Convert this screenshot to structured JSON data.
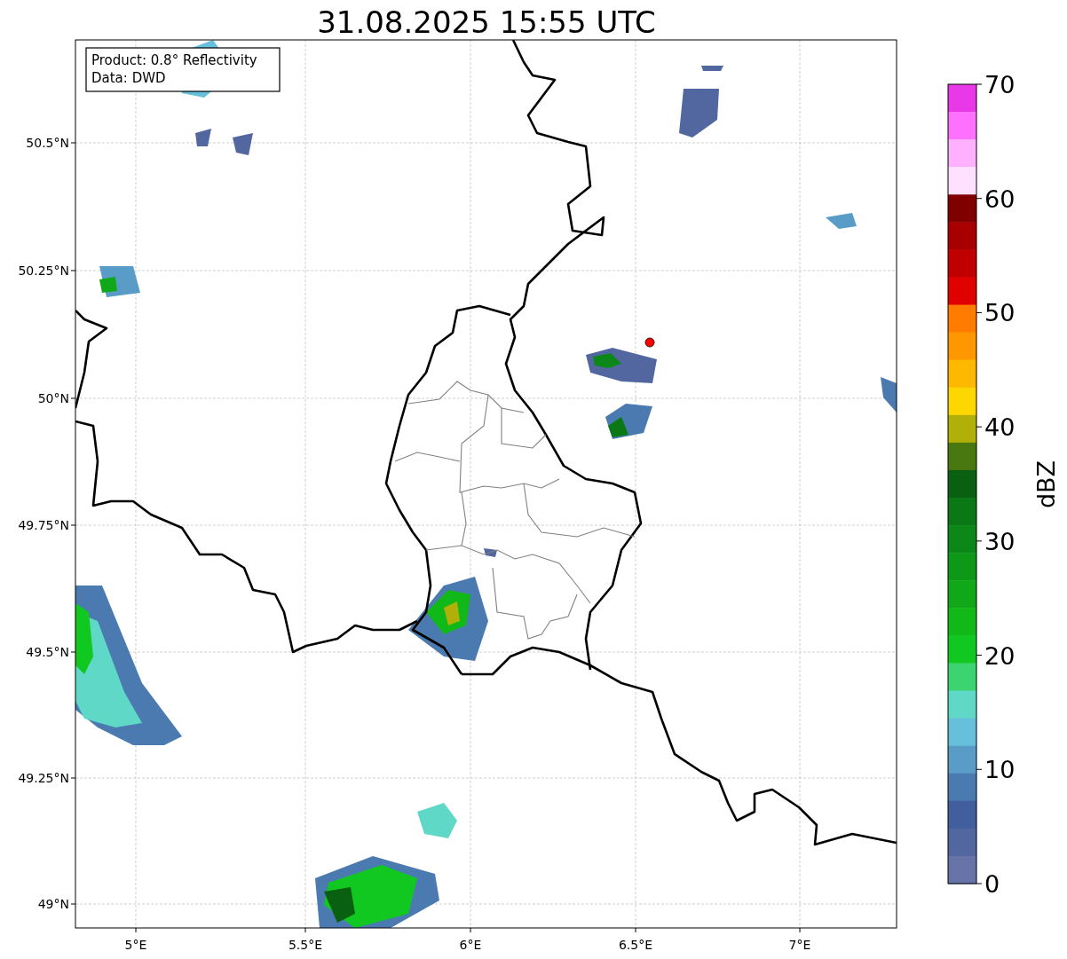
{
  "title": "31.08.2025 15:55 UTC",
  "map": {
    "info_box": [
      "Product: 0.8° Reflectivity",
      "Data: DWD"
    ],
    "xticks": [
      "5°E",
      "5.5°E",
      "6°E",
      "6.5°E",
      "7°E"
    ],
    "yticks": [
      "50.5°N",
      "50.25°N",
      "50°N",
      "49.75°N",
      "49.5°N",
      "49.25°N",
      "49°N"
    ]
  },
  "colorbar": {
    "label": "dBZ",
    "ticks": [
      "70",
      "60",
      "50",
      "40",
      "30",
      "20",
      "10",
      "0"
    ],
    "segments": [
      {
        "color": "#e838e8"
      },
      {
        "color": "#ff70ff"
      },
      {
        "color": "#ffb0ff"
      },
      {
        "color": "#ffe0ff"
      },
      {
        "color": "#800000"
      },
      {
        "color": "#a80000"
      },
      {
        "color": "#c00000"
      },
      {
        "color": "#e00000"
      },
      {
        "color": "#ff7c00"
      },
      {
        "color": "#ff9800"
      },
      {
        "color": "#ffb800"
      },
      {
        "color": "#ffd700"
      },
      {
        "color": "#b0b008"
      },
      {
        "color": "#4a7810"
      },
      {
        "color": "#086010"
      },
      {
        "color": "#0a7814"
      },
      {
        "color": "#0c8818"
      },
      {
        "color": "#0e9818"
      },
      {
        "color": "#10a818"
      },
      {
        "color": "#10b818"
      },
      {
        "color": "#10c820"
      },
      {
        "color": "#3cd470"
      },
      {
        "color": "#60d8c8"
      },
      {
        "color": "#66c0dc"
      },
      {
        "color": "#5a9cc8"
      },
      {
        "color": "#4a7ab0"
      },
      {
        "color": "#425e9e"
      },
      {
        "color": "#5266a0"
      },
      {
        "color": "#6674a8"
      }
    ]
  }
}
